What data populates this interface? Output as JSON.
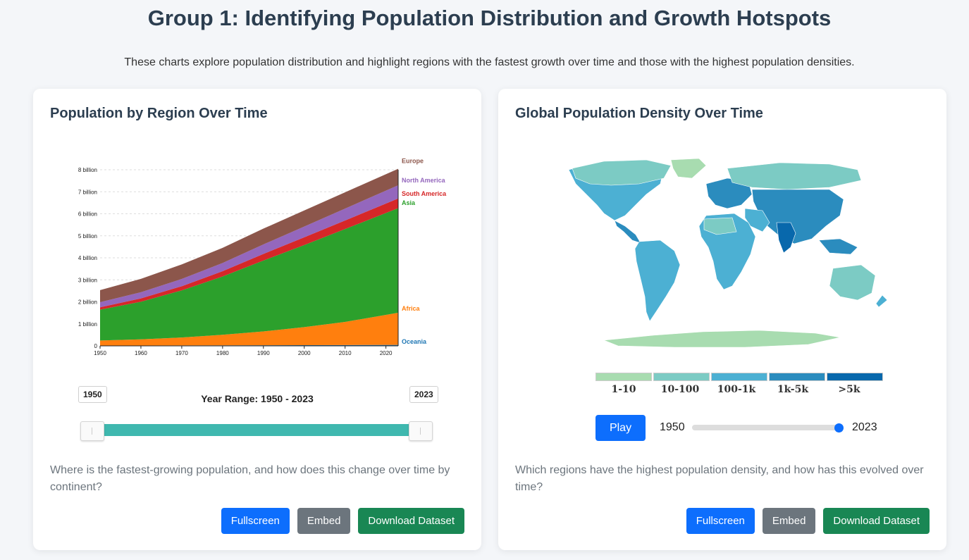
{
  "page": {
    "title": "Group 1: Identifying Population Distribution and Growth Hotspots",
    "subtitle": "These charts explore population distribution and highlight regions with the fastest growth over time and those with the highest population densities."
  },
  "left_card": {
    "title": "Population by Region Over Time",
    "range_label": "Year Range: 1950 - 2023",
    "range_start": "1950",
    "range_end": "2023",
    "question": "Where is the fastest-growing population, and how does this change over time by continent?",
    "buttons": {
      "fullscreen": "Fullscreen",
      "embed": "Embed",
      "download": "Download Dataset"
    }
  },
  "right_card": {
    "title": "Global Population Density Over Time",
    "legend": [
      {
        "label": "1-10",
        "color": "#a8dcb0"
      },
      {
        "label": "10-100",
        "color": "#7ccbc4"
      },
      {
        "label": "100-1k",
        "color": "#4cb0d3"
      },
      {
        "label": "1k-5k",
        "color": "#2b8cbe"
      },
      {
        "label": ">5k",
        "color": "#0868ac"
      }
    ],
    "play_label": "Play",
    "year_min": "1950",
    "year_max": "2023",
    "year_value": 2023,
    "question": "Which regions have the highest population density, and how has this evolved over time?",
    "buttons": {
      "fullscreen": "Fullscreen",
      "embed": "Embed",
      "download": "Download Dataset"
    }
  },
  "chart_data": {
    "type": "area",
    "stacked": true,
    "x": [
      1950,
      1960,
      1970,
      1980,
      1990,
      2000,
      2010,
      2023
    ],
    "xticks": [
      "1950",
      "1960",
      "1970",
      "1980",
      "1990",
      "2000",
      "2010",
      "2020"
    ],
    "yticks": [
      "0",
      "1 billion",
      "2 billion",
      "3 billion",
      "4 billion",
      "5 billion",
      "6 billion",
      "7 billion",
      "8 billion"
    ],
    "ylim": [
      0,
      8
    ],
    "grid": true,
    "series": [
      {
        "name": "Oceania",
        "color": "#1f77b4",
        "values": [
          0.013,
          0.016,
          0.02,
          0.023,
          0.027,
          0.031,
          0.037,
          0.045
        ]
      },
      {
        "name": "Africa",
        "color": "#ff7f0e",
        "values": [
          0.23,
          0.28,
          0.36,
          0.48,
          0.63,
          0.82,
          1.05,
          1.46
        ]
      },
      {
        "name": "Asia",
        "color": "#2ca02c",
        "values": [
          1.4,
          1.71,
          2.14,
          2.65,
          3.22,
          3.73,
          4.22,
          4.75
        ]
      },
      {
        "name": "South America",
        "color": "#d62728",
        "values": [
          0.11,
          0.15,
          0.19,
          0.24,
          0.3,
          0.35,
          0.39,
          0.44
        ]
      },
      {
        "name": "North America",
        "color": "#9467bd",
        "values": [
          0.23,
          0.28,
          0.33,
          0.37,
          0.43,
          0.49,
          0.54,
          0.6
        ]
      },
      {
        "name": "Europe",
        "color": "#8c564b",
        "values": [
          0.55,
          0.61,
          0.66,
          0.69,
          0.72,
          0.73,
          0.74,
          0.75
        ]
      }
    ]
  }
}
